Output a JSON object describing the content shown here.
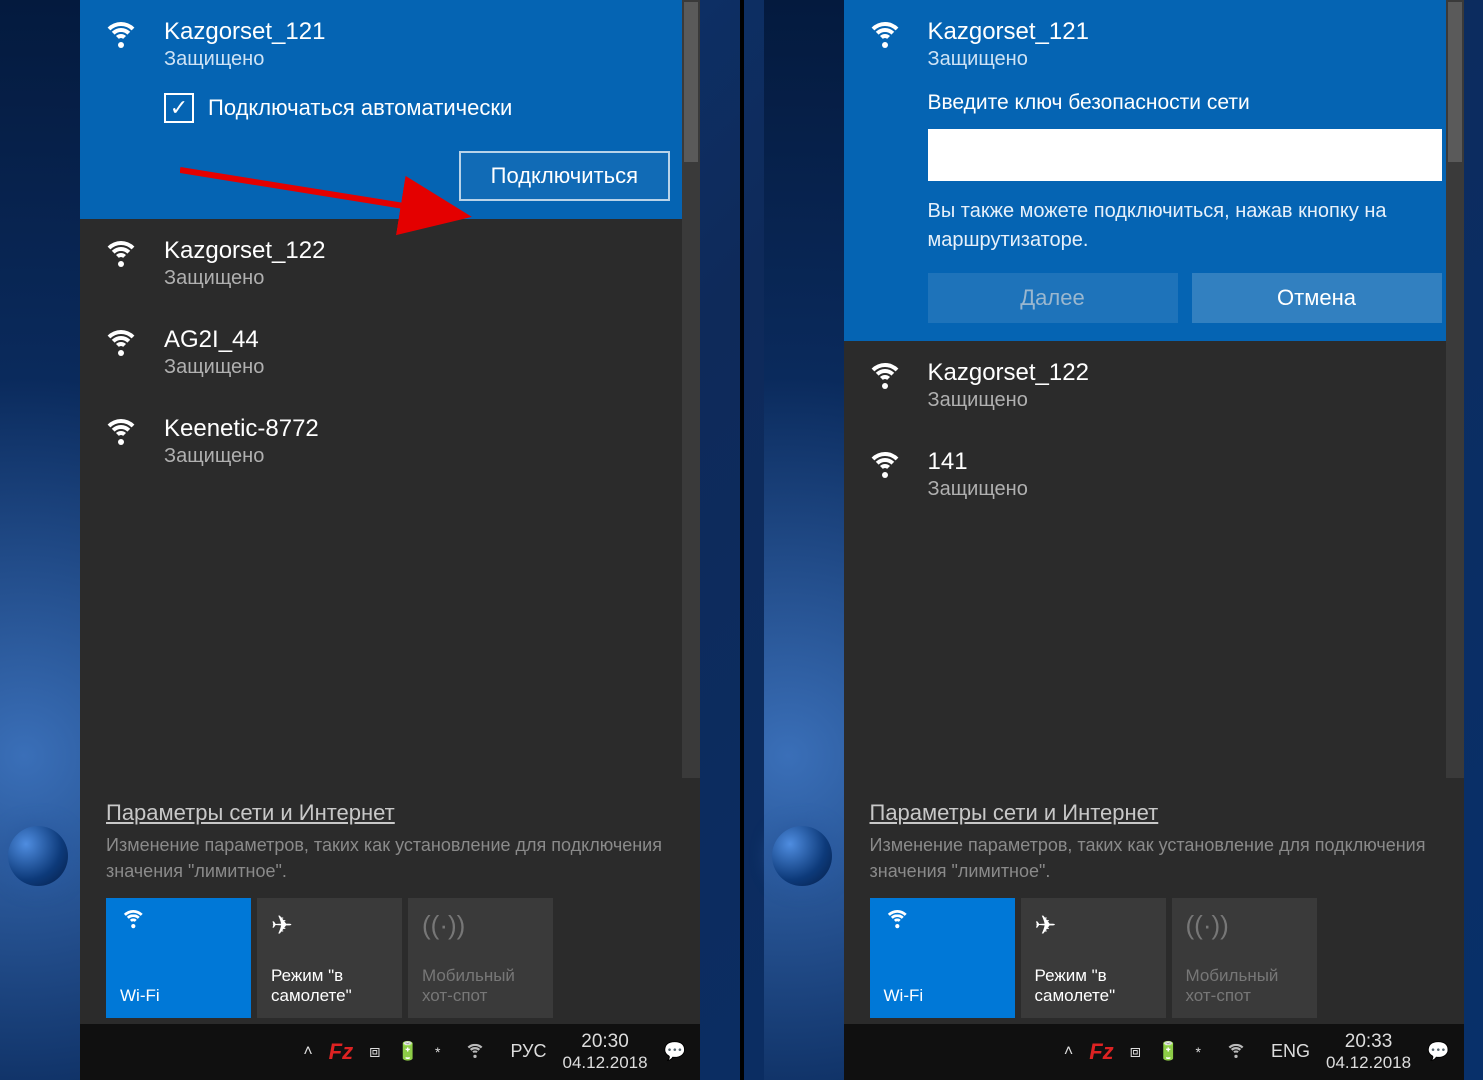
{
  "panels": [
    {
      "networks": [
        {
          "ssid": "Kazgorset_121",
          "status": "Защищено",
          "selected": true,
          "auto_label": "Подключаться автоматически",
          "connect_label": "Подключиться"
        },
        {
          "ssid": "Kazgorset_122",
          "status": "Защищено"
        },
        {
          "ssid": "AG2I_44",
          "status": "Защищено"
        },
        {
          "ssid": "Keenetic-8772",
          "status": "Защищено"
        }
      ],
      "settings": {
        "title": "Параметры сети и Интернет",
        "desc": "Изменение параметров, таких как установление для подключения значения \"лимитное\"."
      },
      "tiles": {
        "wifi": "Wi-Fi",
        "airplane": "Режим \"в самолете\"",
        "hotspot": "Мобильный хот-спот"
      },
      "tray": {
        "lang": "РУС",
        "time": "20:30",
        "date": "04.12.2018"
      }
    },
    {
      "networks": [
        {
          "ssid": "Kazgorset_121",
          "status": "Защищено",
          "selected": true,
          "prompt": "Введите ключ безопасности сети",
          "hint": "Вы также можете подключиться, нажав кнопку на маршрутизаторе.",
          "next_label": "Далее",
          "cancel_label": "Отмена"
        },
        {
          "ssid": "Kazgorset_122",
          "status": "Защищено"
        },
        {
          "ssid": "141",
          "status": "Защищено"
        }
      ],
      "settings": {
        "title": "Параметры сети и Интернет",
        "desc": "Изменение параметров, таких как установление для подключения значения \"лимитное\"."
      },
      "tiles": {
        "wifi": "Wi-Fi",
        "airplane": "Режим \"в самолете\"",
        "hotspot": "Мобильный хот-спот"
      },
      "tray": {
        "lang": "ENG",
        "time": "20:33",
        "date": "04.12.2018"
      }
    }
  ]
}
